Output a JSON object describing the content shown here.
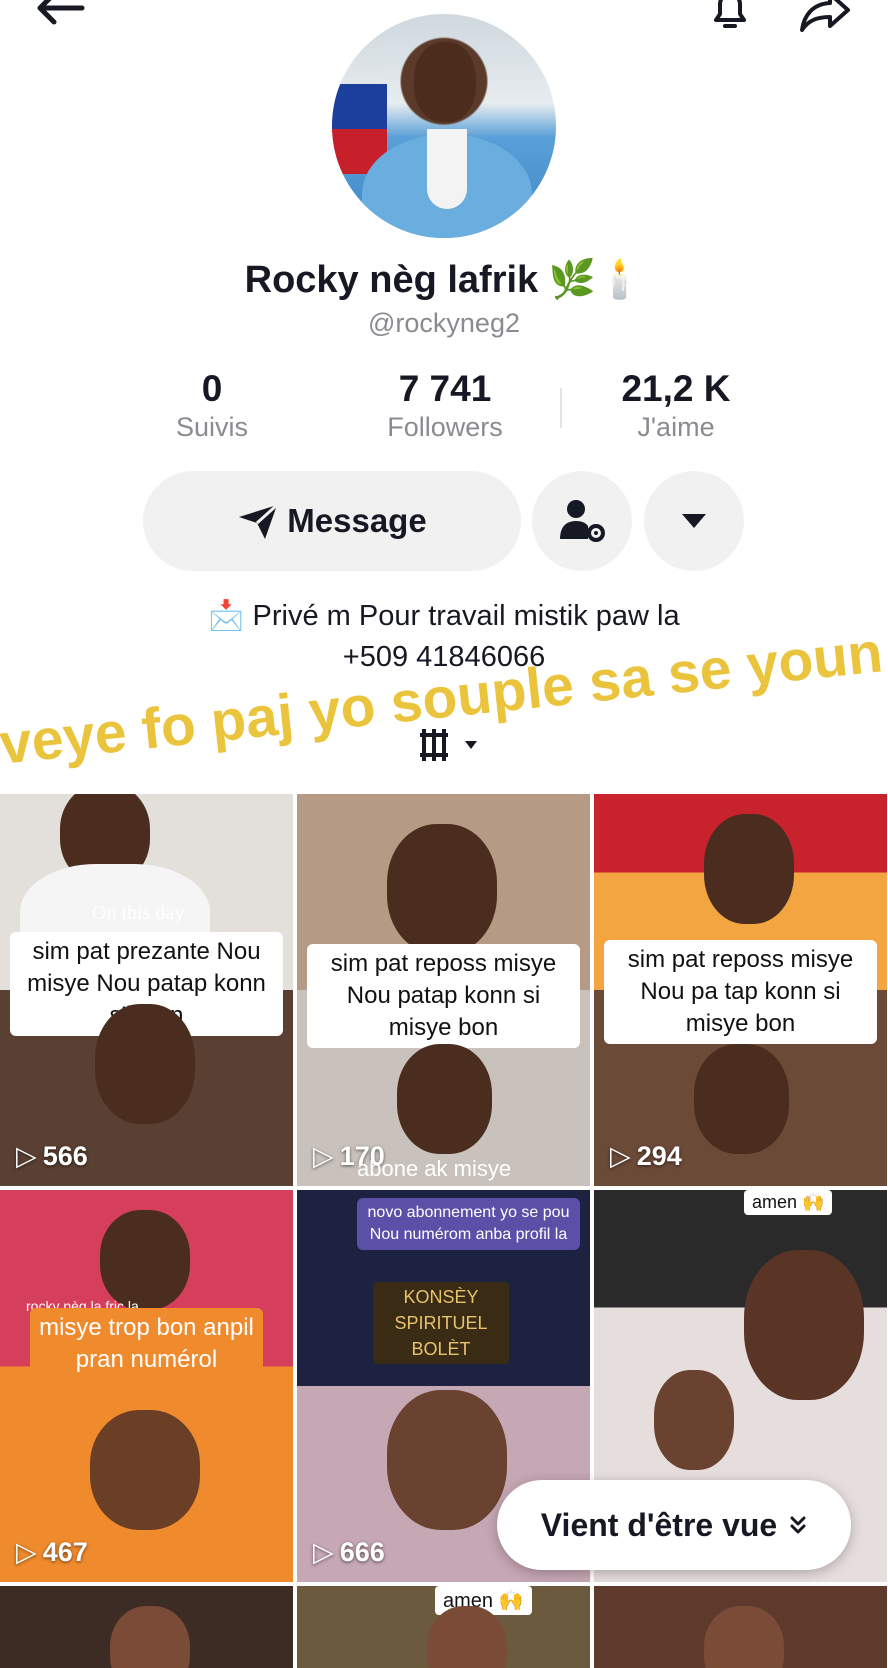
{
  "profile": {
    "name": "Rocky nèg lafrik 🌿🕯️",
    "handle": "@rockyneg2",
    "stats": [
      {
        "value": "0",
        "label": "Suivis"
      },
      {
        "value": "7 741",
        "label": "Followers"
      },
      {
        "value": "21,2 K",
        "label": "J'aime"
      }
    ],
    "message_label": "Message",
    "bio_line1": "📩 Privé m Pour travail mistik paw la",
    "bio_line2": "+509 41846066"
  },
  "overlay_caption": "veye fo paj yo souple sa se youn",
  "grid": [
    {
      "text": "sim pat prezante Nou misye Nou patap konn s'il bon",
      "views": "566",
      "extra": "On this day"
    },
    {
      "text": "sim pat reposs misye Nou patap konn si misye bon",
      "views": "170",
      "extra": "abone ak misye"
    },
    {
      "text": "sim pat reposs misye Nou pa tap konn si misye bon",
      "views": "294",
      "extra": ""
    },
    {
      "text": "misye trop bon anpil pran numérol",
      "views": "467",
      "extra": "rocky nèg la fric la"
    },
    {
      "text": "novo abonnement yo se pou Nou numérom anba profil la",
      "views": "666",
      "extra": "KONSÈY SPIRITUEL BOLÈT"
    },
    {
      "text": "amen 🙌",
      "views": "",
      "extra": ""
    },
    {
      "text": "",
      "views": "",
      "extra": ""
    },
    {
      "text": "amen 🙌",
      "views": "",
      "extra": ""
    },
    {
      "text": "",
      "views": "",
      "extra": ""
    }
  ],
  "recent_pill": "Vient d'être vue",
  "colors": {
    "caption": "#ebc43e",
    "button_bg": "#f1f1f2",
    "muted_text": "#8a8b91"
  }
}
